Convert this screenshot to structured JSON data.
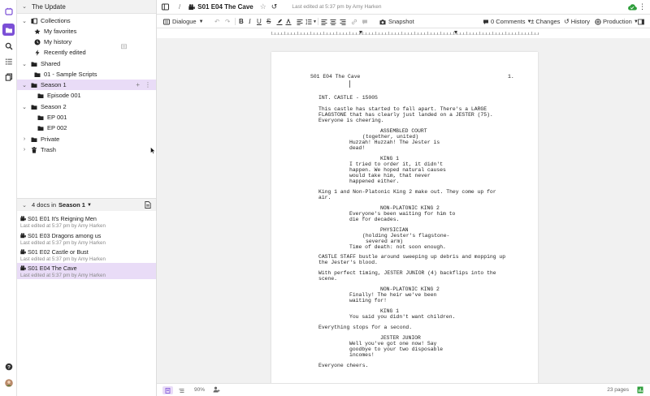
{
  "workspace": {
    "title": "The Update"
  },
  "sidebar": {
    "collections_label": "Collections",
    "collection_items": [
      "My favorites",
      "My history",
      "Recently edited"
    ],
    "shared_label": "Shared",
    "shared_items": [
      "01 - Sample Scripts",
      "Season 1",
      "Episode 001",
      "Season 2",
      "EP 001",
      "EP 002"
    ],
    "private_label": "Private",
    "trash_label": "Trash"
  },
  "docs_panel": {
    "count_label": "4 docs in",
    "folder": "Season 1",
    "docs": [
      {
        "title": "S01 E01 It's Reigning Men",
        "meta": "Last edited at 5:37 pm by Amy Harken"
      },
      {
        "title": "S01 E03 Dragons among us",
        "meta": "Last edited at 5:37 pm by Amy Harken"
      },
      {
        "title": "S01 E02 Castle or Bust",
        "meta": "Last edited at 5:37 pm by Amy Harken"
      },
      {
        "title": "S01 E04 The Cave",
        "meta": "Last edited at 5:37 pm by Amy Harken"
      }
    ]
  },
  "topbar": {
    "breadcrumb_sep": "/",
    "doc_title": "S01 E04 The Cave",
    "edited": "Last edited at 5:37 pm by Amy Harken"
  },
  "toolbar": {
    "element_type": "Dialogue",
    "snapshot": "Snapshot",
    "comments": "0 Comments",
    "changes": "Changes",
    "history": "History",
    "mode": "Production"
  },
  "script": {
    "header_left": "S01 E04 The Cave",
    "page_number": "1.",
    "lines": [
      "INT. CASTLE - 1500S",
      "This castle has started to fall apart. There's a LARGE",
      "FLAGSTONE that has clearly just landed on a JESTER (75).",
      "Everyone is cheering.",
      "ASSEMBLED COURT",
      "(together, united)",
      "Huzzah! Huzzah! The Jester is",
      "dead!",
      "KING 1",
      "I tried to order it, it didn't",
      "happen. We hoped natural causes",
      "would take him, that never",
      "happened either.",
      "King 1 and Non-Platonic King 2 make out. They come up for",
      "air.",
      "NON-PLATONIC KING 2",
      "Everyone's been waiting for him to",
      "die for decades.",
      "PHYSICIAN",
      "(holding Jester's flagstone-",
      "severed arm)",
      "Time of death: not soon enough.",
      "CASTLE STAFF bustle around sweeping up debris and mopping up",
      "the Jester's blood.",
      "With perfect timing, JESTER JUNIOR (4) backflips into the",
      "scene.",
      "NON-PLATONIC KING 2",
      "Finally! The heir we've been",
      "waiting for!",
      "KING 1",
      "You said you didn't want children.",
      "Everything stops for a second.",
      "JESTER JUNIOR",
      "Well you've got one now! Say",
      "goodbye to your two disposable",
      "incomes!",
      "Everyone cheers."
    ]
  },
  "bottombar": {
    "zoom": "90%",
    "pages": "23 pages"
  }
}
